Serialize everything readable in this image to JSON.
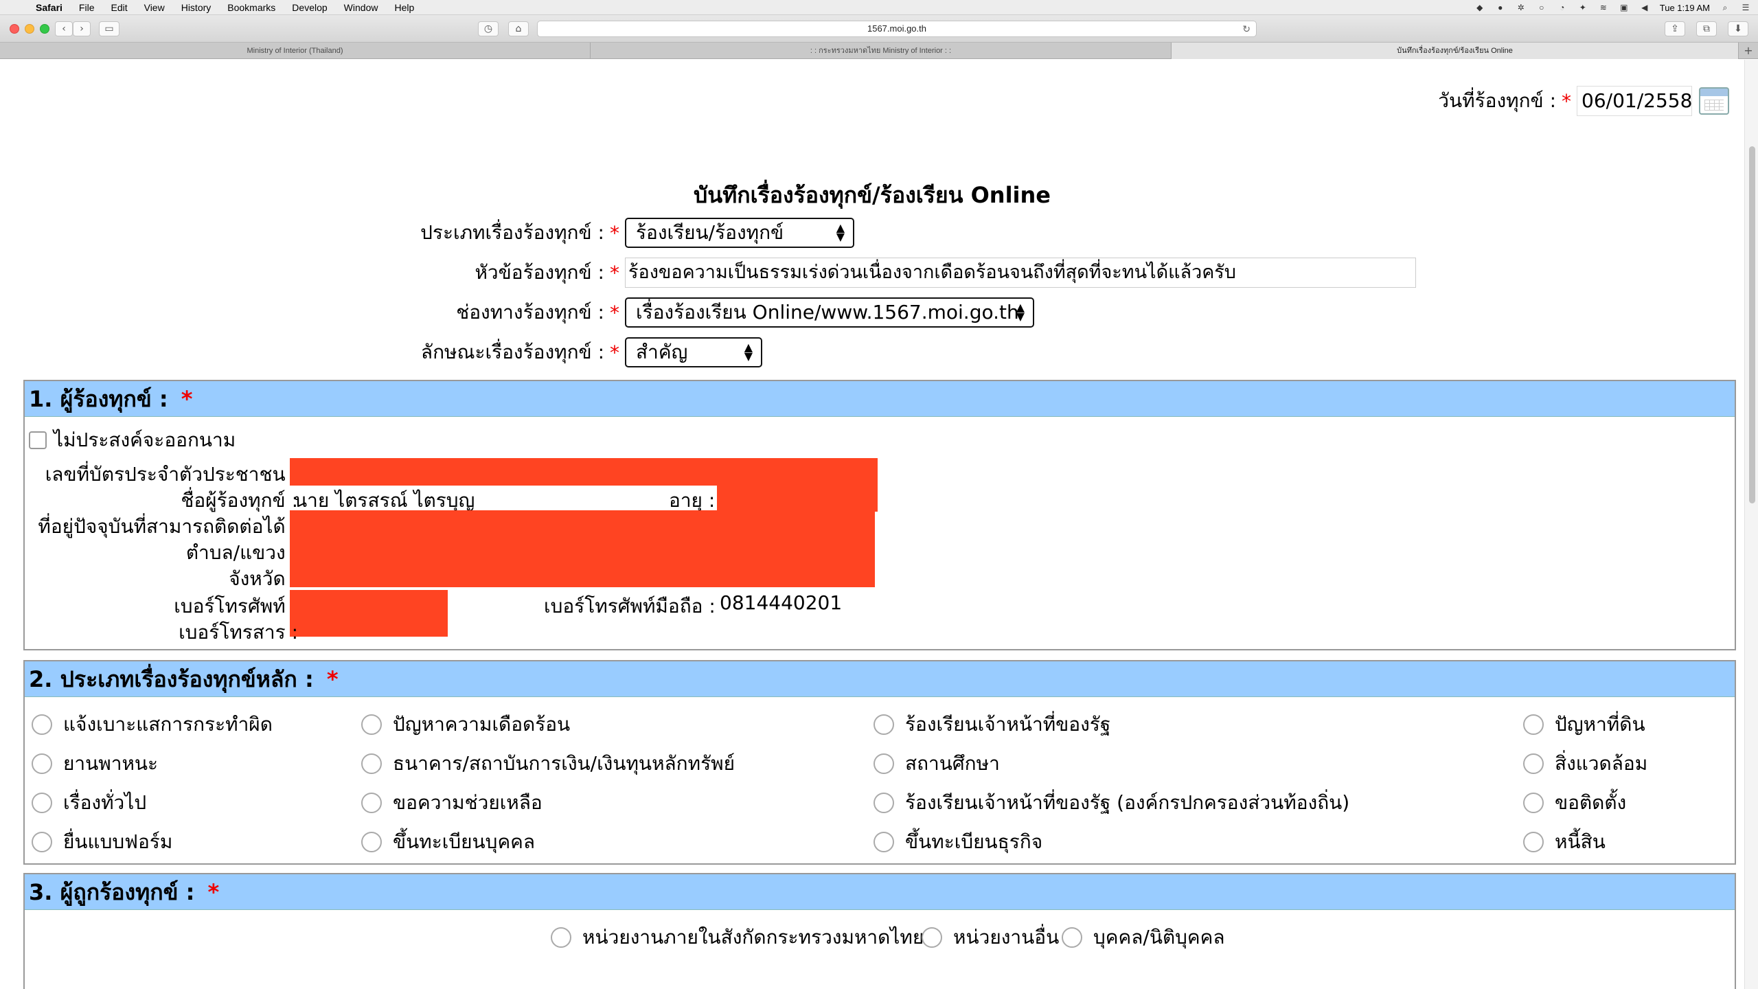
{
  "menubar": {
    "app": "Safari",
    "items": [
      "File",
      "Edit",
      "View",
      "History",
      "Bookmarks",
      "Develop",
      "Window",
      "Help"
    ],
    "clock": "Tue 1:19 AM"
  },
  "browser": {
    "url": "1567.moi.go.th",
    "tabs": [
      "Ministry of Interior (Thailand)",
      ": : กระทรวงมหาดไทย Ministry of Interior : :",
      "บันทึกเรื่องร้องทุกข์/ร้องเรียน Online"
    ]
  },
  "header": {
    "date_label": "วันที่ร้องทุกข์ :",
    "date_value": "06/01/2558",
    "required_mark": "*"
  },
  "form": {
    "title": "บันทึกเรื่องร้องทุกข์/ร้องเรียน Online",
    "type_label": "ประเภทเรื่องร้องทุกข์ :",
    "type_value": "ร้องเรียน/ร้องทุกข์",
    "subject_label": "หัวข้อร้องทุกข์ :",
    "subject_value": "ร้องขอความเป็นธรรมเร่งด่วนเนื่องจากเดือดร้อนจนถึงที่สุดที่จะทนได้แล้วครับ",
    "channel_label": "ช่องทางร้องทุกข์ :",
    "channel_value": "เรื่องร้องเรียน Online/www.1567.moi.go.th",
    "nature_label": "ลักษณะเรื่องร้องทุกข์ :",
    "nature_value": "สำคัญ"
  },
  "section1": {
    "title": "1. ผู้ร้องทุกข์ :",
    "anonymous_label": "ไม่ประสงค์จะออกนาม",
    "id_label": "เลขที่บัตรประจำตัวประชาชน :",
    "name_label": "ชื่อผู้ร้องทุกข์ :",
    "name_value": "นาย ไตรสรณ์ ไตรบุญ",
    "age_label": "อายุ :",
    "address_label": "ที่อยู่ปัจจุบันที่สามารถติดต่อได้ :",
    "subdistrict_label": "ตำบล/แขวง :",
    "province_label": "จังหวัด :",
    "phone_label": "เบอร์โทรศัพท์ :",
    "mobile_label": "เบอร์โทรศัพท์มือถือ :",
    "mobile_value": "0814440201",
    "fax_label": "เบอร์โทรสาร :"
  },
  "section2": {
    "title": "2. ประเภทเรื่องร้องทุกข์หลัก :",
    "options": [
      "แจ้งเบาะแสการกระทำผิด",
      "ปัญหาความเดือดร้อน",
      "ร้องเรียนเจ้าหน้าที่ของรัฐ",
      "ปัญหาที่ดิน",
      "ยานพาหนะ",
      "ธนาคาร/สถาบันการเงิน/เงินทุนหลักทรัพย์",
      "สถานศึกษา",
      "สิ่งแวดล้อม",
      "เรื่องทั่วไป",
      "ขอความช่วยเหลือ",
      "ร้องเรียนเจ้าหน้าที่ของรัฐ (องค์กรปกครองส่วนท้องถิ่น)",
      "ขอติดตั้ง",
      "ยื่นแบบฟอร์ม",
      "ขึ้นทะเบียนบุคคล",
      "ขึ้นทะเบียนธุรกิจ",
      "หนี้สิน"
    ]
  },
  "section3": {
    "title": "3. ผู้ถูกร้องทุกข์ :",
    "options": [
      "หน่วยงานภายในสังกัดกระทรวงมหาดไทย",
      "หน่วยงานอื่น",
      "บุคคล/นิติบุคคล"
    ]
  },
  "colors": {
    "section_header": "#99ccff",
    "required": "#ee0000",
    "redaction": "#ff4422"
  }
}
